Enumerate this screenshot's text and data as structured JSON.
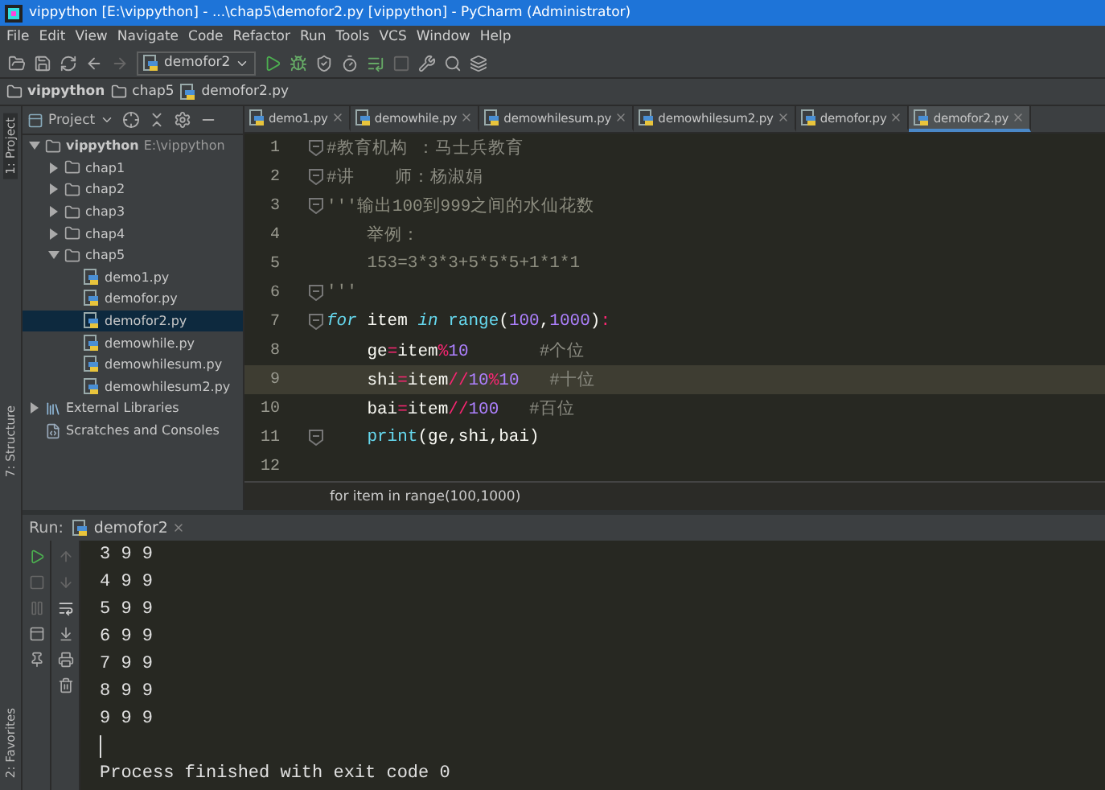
{
  "window": {
    "title": "vippython [E:\\vippython] - ...\\chap5\\demofor2.py [vippython] - PyCharm (Administrator)"
  },
  "menu": [
    "File",
    "Edit",
    "View",
    "Navigate",
    "Code",
    "Refactor",
    "Run",
    "Tools",
    "VCS",
    "Window",
    "Help"
  ],
  "toolbar": {
    "run_config": "demofor2"
  },
  "breadcrumb": [
    "vippython",
    "chap5",
    "demofor2.py"
  ],
  "side_tabs": [
    {
      "label": "1: Project",
      "selected": true
    },
    {
      "label": "7: Structure",
      "selected": false
    },
    {
      "label": "2: Favorites",
      "selected": false
    }
  ],
  "project_panel": {
    "title": "Project",
    "tree": [
      {
        "label": "vippython",
        "path": "E:\\vippython",
        "kind": "root",
        "expanded": true,
        "selected": false,
        "children": [
          {
            "label": "chap1",
            "kind": "folder",
            "expanded": false,
            "selected": false
          },
          {
            "label": "chap2",
            "kind": "folder",
            "expanded": false,
            "selected": false
          },
          {
            "label": "chap3",
            "kind": "folder",
            "expanded": false,
            "selected": false
          },
          {
            "label": "chap4",
            "kind": "folder",
            "expanded": false,
            "selected": false
          },
          {
            "label": "chap5",
            "kind": "folder",
            "expanded": true,
            "selected": false,
            "children": [
              {
                "label": "demo1.py",
                "kind": "file",
                "selected": false
              },
              {
                "label": "demofor.py",
                "kind": "file",
                "selected": false
              },
              {
                "label": "demofor2.py",
                "kind": "file",
                "selected": true
              },
              {
                "label": "demowhile.py",
                "kind": "file",
                "selected": false
              },
              {
                "label": "demowhilesum.py",
                "kind": "file",
                "selected": false
              },
              {
                "label": "demowhilesum2.py",
                "kind": "file",
                "selected": false
              }
            ]
          }
        ]
      },
      {
        "label": "External Libraries",
        "kind": "library",
        "expanded": false,
        "selected": false
      },
      {
        "label": "Scratches and Consoles",
        "kind": "scratches",
        "selected": false
      }
    ]
  },
  "editor_tabs": [
    {
      "label": "demo1.py",
      "selected": false
    },
    {
      "label": "demowhile.py",
      "selected": false
    },
    {
      "label": "demowhilesum.py",
      "selected": false
    },
    {
      "label": "demowhilesum2.py",
      "selected": false
    },
    {
      "label": "demofor.py",
      "selected": false
    },
    {
      "label": "demofor2.py",
      "selected": true
    }
  ],
  "code_lines": [
    {
      "number": "1",
      "fold": true,
      "current": false,
      "tokens": [
        {
          "text": "#教育机构 ：马士兵教育",
          "kind": "comment"
        }
      ]
    },
    {
      "number": "2",
      "fold": true,
      "current": false,
      "tokens": [
        {
          "text": "#讲    师：杨淑娟",
          "kind": "comment"
        }
      ]
    },
    {
      "number": "3",
      "fold": true,
      "current": false,
      "tokens": [
        {
          "text": "'''输出100到999之间的水仙花数",
          "kind": "docstring"
        }
      ]
    },
    {
      "number": "4",
      "fold": false,
      "current": false,
      "tokens": [
        {
          "text": "    举例：",
          "kind": "docstring"
        }
      ]
    },
    {
      "number": "5",
      "fold": false,
      "current": false,
      "tokens": [
        {
          "text": "    153=3*3*3+5*5*5+1*1*1",
          "kind": "docstring"
        }
      ]
    },
    {
      "number": "6",
      "fold": true,
      "current": false,
      "tokens": [
        {
          "text": "'''",
          "kind": "docstring"
        }
      ]
    },
    {
      "number": "7",
      "fold": true,
      "current": false,
      "tokens": [
        {
          "text": "for",
          "kind": "keyword"
        },
        {
          "text": " item ",
          "kind": "plain"
        },
        {
          "text": "in",
          "kind": "keyword"
        },
        {
          "text": " range",
          "kind": "builtin"
        },
        {
          "text": "(",
          "kind": "plain"
        },
        {
          "text": "100",
          "kind": "number"
        },
        {
          "text": ",",
          "kind": "plain"
        },
        {
          "text": "1000",
          "kind": "number"
        },
        {
          "text": ")",
          "kind": "plain"
        },
        {
          "text": ":",
          "kind": "operator"
        }
      ]
    },
    {
      "number": "8",
      "fold": false,
      "current": false,
      "tokens": [
        {
          "text": "    ge",
          "kind": "plain"
        },
        {
          "text": "=",
          "kind": "operator"
        },
        {
          "text": "item",
          "kind": "plain"
        },
        {
          "text": "%",
          "kind": "operator"
        },
        {
          "text": "10",
          "kind": "number"
        },
        {
          "text": "       #个位",
          "kind": "comment"
        }
      ]
    },
    {
      "number": "9",
      "fold": false,
      "current": true,
      "tokens": [
        {
          "text": "    shi",
          "kind": "plain"
        },
        {
          "text": "=",
          "kind": "operator"
        },
        {
          "text": "item",
          "kind": "plain"
        },
        {
          "text": "//",
          "kind": "operator"
        },
        {
          "text": "10",
          "kind": "number"
        },
        {
          "text": "%",
          "kind": "operator"
        },
        {
          "text": "10",
          "kind": "number"
        },
        {
          "text": "   #十位",
          "kind": "comment"
        }
      ]
    },
    {
      "number": "10",
      "fold": false,
      "current": false,
      "tokens": [
        {
          "text": "    bai",
          "kind": "plain"
        },
        {
          "text": "=",
          "kind": "operator"
        },
        {
          "text": "item",
          "kind": "plain"
        },
        {
          "text": "//",
          "kind": "operator"
        },
        {
          "text": "100",
          "kind": "number"
        },
        {
          "text": "   #百位",
          "kind": "comment"
        }
      ]
    },
    {
      "number": "11",
      "fold": true,
      "current": false,
      "tokens": [
        {
          "text": "    print",
          "kind": "builtin"
        },
        {
          "text": "(ge,shi,bai)",
          "kind": "plain"
        }
      ]
    },
    {
      "number": "12",
      "fold": false,
      "current": false
    }
  ],
  "editor_breadcrumb": "for item in range(100,1000)",
  "run_panel": {
    "label": "Run:",
    "tab": "demofor2",
    "output": [
      {
        "kind": "text",
        "text": "3 9 9"
      },
      {
        "kind": "text",
        "text": "4 9 9"
      },
      {
        "kind": "text",
        "text": "5 9 9"
      },
      {
        "kind": "text",
        "text": "6 9 9"
      },
      {
        "kind": "text",
        "text": "7 9 9"
      },
      {
        "kind": "text",
        "text": "8 9 9"
      },
      {
        "kind": "text",
        "text": "9 9 9"
      },
      {
        "kind": "cursor"
      },
      {
        "kind": "text",
        "text": "Process finished with exit code 0"
      }
    ]
  }
}
